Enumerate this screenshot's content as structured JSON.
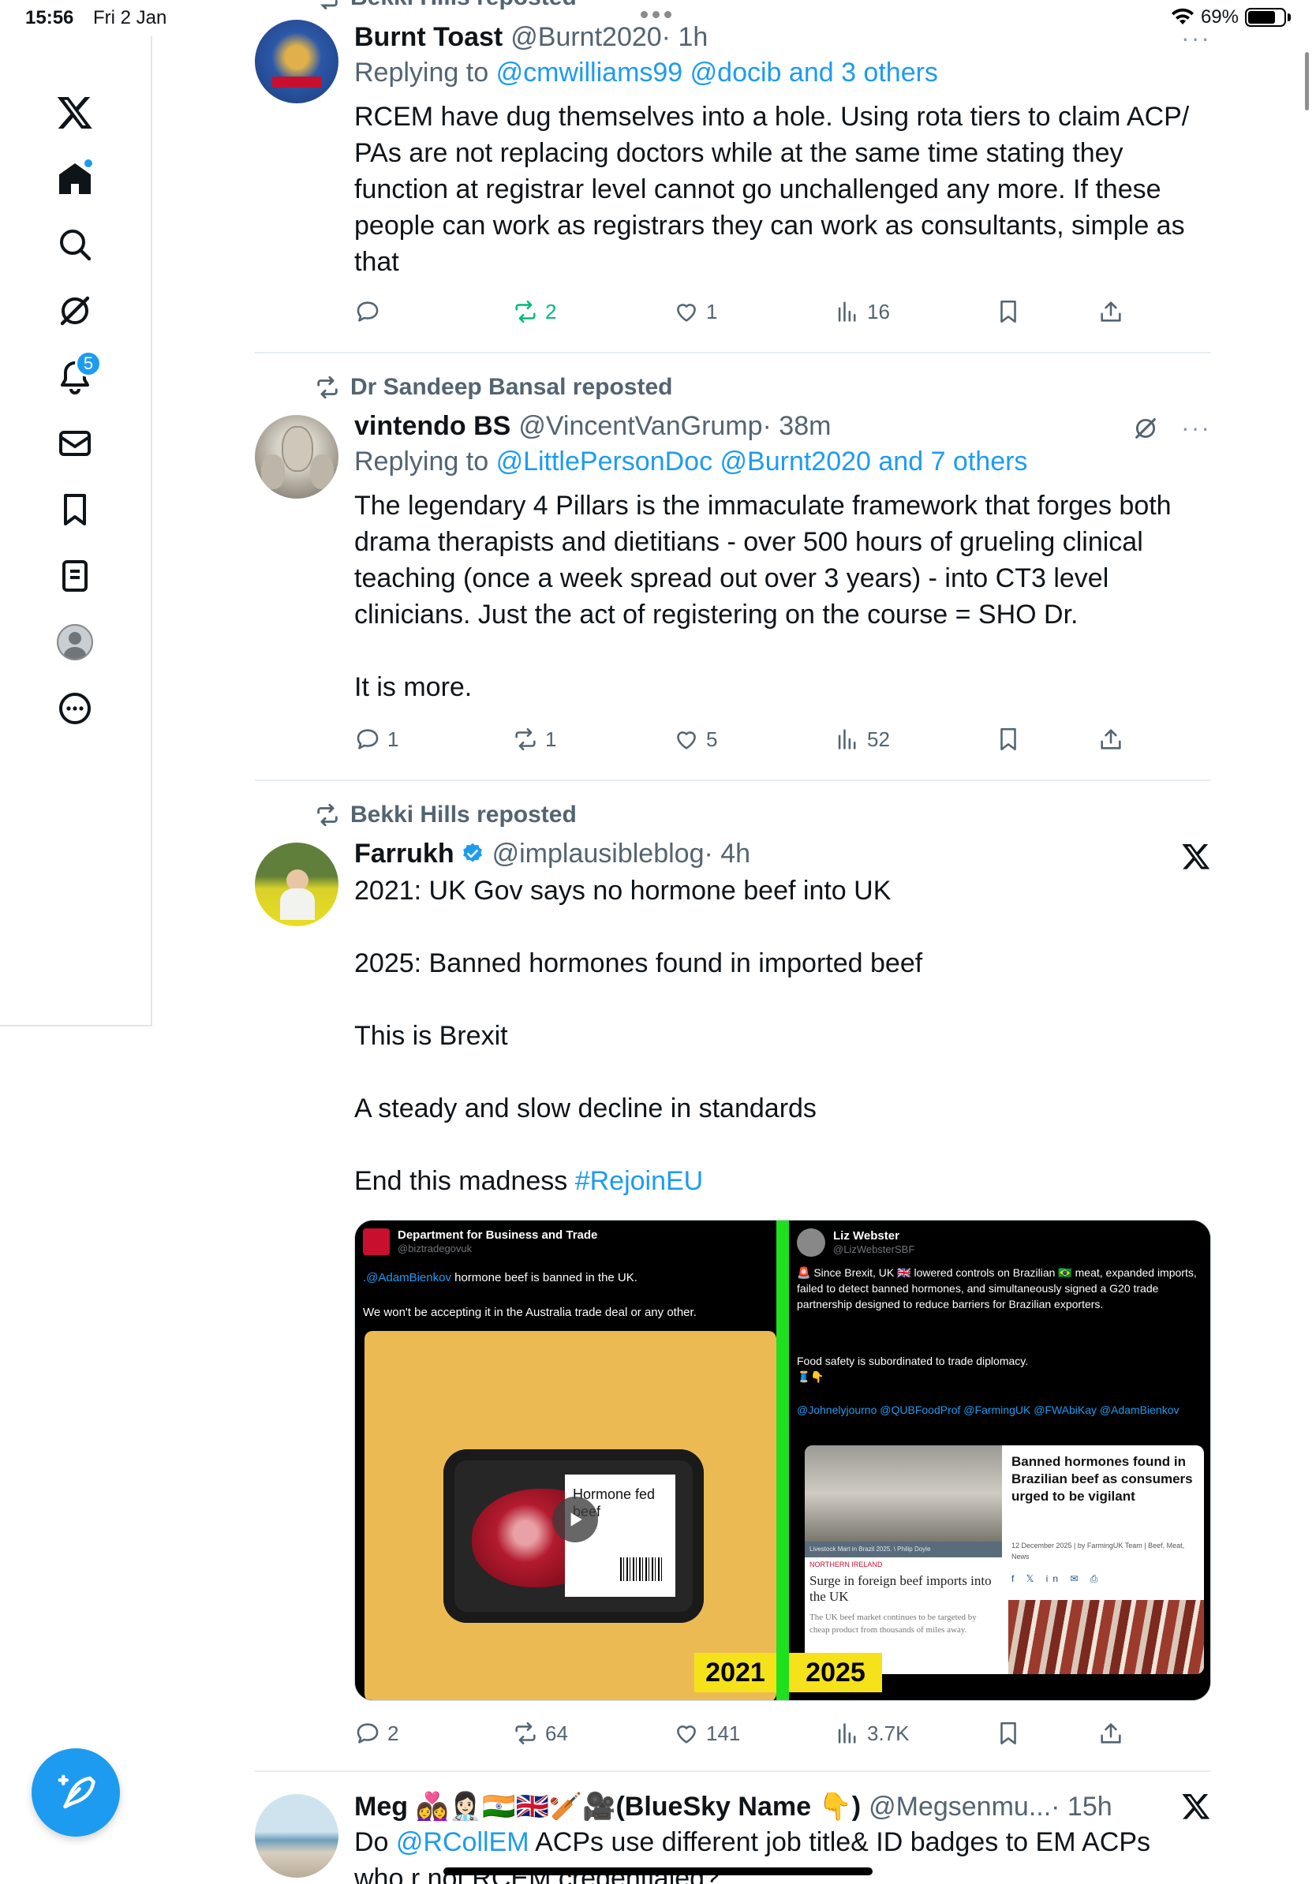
{
  "status_bar": {
    "time": "15:56",
    "date": "Fri 2 Jan",
    "battery": "69%"
  },
  "sidebar": {
    "notifications_badge": "5",
    "items": [
      "logo",
      "home",
      "search",
      "grok",
      "notifications",
      "messages",
      "bookmarks",
      "lists",
      "profile",
      "more"
    ]
  },
  "tweets": [
    {
      "repost_line": "Bekki Hills reposted",
      "name": "Burnt Toast",
      "handle": "@Burnt2020",
      "time": "· 1h",
      "reply_prefix": "Replying to",
      "mentions": "@cmwilliams99 @docib and 3 others",
      "text": "RCEM have dug themselves into a hole. Using rota tiers to claim ACP/ PAs are not replacing doctors while at the same time stating they function at registrar level cannot go unchallenged any more. If these people can work as registrars they can work as consultants, simple as that",
      "stats": {
        "replies": "",
        "reposts": "2",
        "likes": "1",
        "views": "16"
      }
    },
    {
      "repost_line": "Dr Sandeep Bansal reposted",
      "name": "vintendo BS",
      "handle": "@VincentVanGrump",
      "time": "· 38m",
      "reply_prefix": "Replying to",
      "mentions": "@LittlePersonDoc @Burnt2020 and 7 others",
      "text": "The legendary 4 Pillars is the immaculate framework that forges both drama therapists and dietitians - over 500 hours of grueling clinical teaching (once a week spread out over 3 years) - into CT3 level clinicians. Just the act of registering on the course = SHO Dr.\n\nIt is more.",
      "stats": {
        "replies": "1",
        "reposts": "1",
        "likes": "5",
        "views": "52"
      }
    },
    {
      "repost_line": "Bekki Hills reposted",
      "name": "Farrukh",
      "handle": "@implausibleblog",
      "time": "· 4h",
      "text": "2021: UK Gov says no hormone beef into UK\n\n2025: Banned hormones found in imported beef\n\nThis is Brexit\n\nA steady and slow decline in standards\n\nEnd this madness ",
      "hashtag": "#RejoinEU",
      "stats": {
        "replies": "2",
        "reposts": "64",
        "likes": "141",
        "views": "3.7K"
      },
      "media": {
        "left": {
          "name": "Department for Business and Trade",
          "handle": "@biztradegovuk",
          "mention": ".@AdamBienkov",
          "line1": " hormone beef is banned in the UK.",
          "line2": "We won't be accepting it in the Australia trade deal or any other.",
          "label": "Hormone fed beef",
          "year": "2021"
        },
        "right": {
          "name": "Liz Webster",
          "handle": "@LizWebsterSBF",
          "text1": "🚨 Since Brexit, UK 🇬🇧 lowered controls on Brazilian 🇧🇷 meat, expanded imports, failed to detect banned hormones, and simultaneously signed a G20 trade partnership designed to reduce barriers for Brazilian exporters.",
          "text2": "Food safety is subordinated to trade diplomacy.",
          "text3": "🧵👇",
          "mentions": "@Johnelyjourno @QUBFoodProf @FarmingUK @FWAbiKay @AdamBienkov",
          "caption": "Livestock Mart in Brazil 2025. \\ Philip Doyle",
          "tag": "NORTHERN IRELAND",
          "headline1": "Surge in foreign beef imports into the UK",
          "body1": "The UK beef market continues to be targeted by cheap product from thousands of miles away.",
          "headline2": "Banned hormones found in Brazilian beef as consumers urged to be vigilant",
          "meta": "12 December 2025 | by FarmingUK Team | Beef, Meat, News",
          "year": "2025"
        }
      }
    },
    {
      "name": "Meg 👩‍❤️‍👩👩🏻‍⚕️🇮🇳🇬🇧🏏🎥(BlueSky Name 👇)",
      "handle": "@Megsenmu...",
      "time": "· 15h",
      "text_prefix": "Do ",
      "mention": "@RCollEM",
      "text_rest": " ACPs use different job title& ID badges to EM ACPs who r not RCEM credentialed?"
    }
  ]
}
